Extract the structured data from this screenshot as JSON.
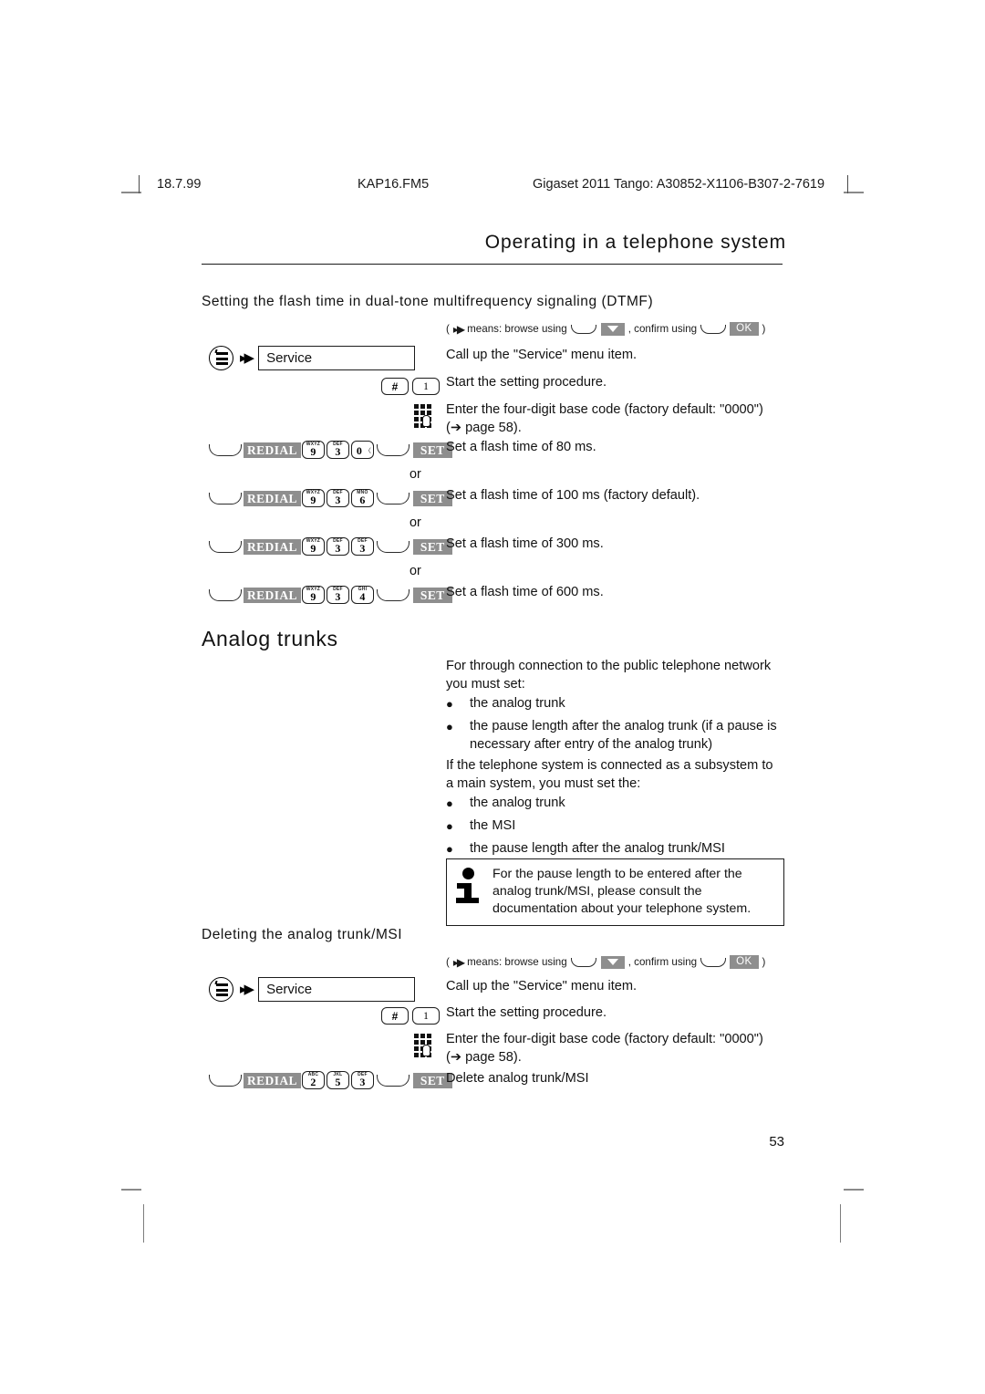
{
  "running_header": {
    "date": "18.7.99",
    "file": "KAP16.FM5",
    "doc_id": "Gigaset 2011 Tango: A30852-X1106-B307-2-7619"
  },
  "chapter_title": "Operating in a telephone system",
  "sections": {
    "dtmf": {
      "heading": "Setting the flash time in dual-tone multifrequency signaling (DTMF)",
      "legend_prefix": "(",
      "legend_means": "means: browse using",
      "legend_confirm": ", confirm using",
      "legend_suffix": ")",
      "ok_label": "OK",
      "service_value": "Service",
      "steps": {
        "call_service": "Call up the \"Service\" menu item.",
        "start_procedure": "Start the setting procedure.",
        "enter_code_line1": "Enter the four-digit base code (factory default: \"0000\")",
        "enter_code_line2": "(➔ page 58)."
      },
      "hash_key": "#",
      "one_key": "1",
      "redial_label": "REDIAL",
      "set_label": "SET",
      "or_label": "or",
      "flash_rows": [
        {
          "keys": [
            {
              "letters": "WXYZ",
              "digit": "9"
            },
            {
              "letters": "DEF",
              "digit": "3"
            },
            {
              "letters": "",
              "digit": "0"
            }
          ],
          "description": "Set a flash time of 80 ms."
        },
        {
          "keys": [
            {
              "letters": "WXYZ",
              "digit": "9"
            },
            {
              "letters": "DEF",
              "digit": "3"
            },
            {
              "letters": "MNO",
              "digit": "6"
            }
          ],
          "description": "Set a flash time of 100 ms (factory default)."
        },
        {
          "keys": [
            {
              "letters": "WXYZ",
              "digit": "9"
            },
            {
              "letters": "DEF",
              "digit": "3"
            },
            {
              "letters": "DEF",
              "digit": "3"
            }
          ],
          "description": "Set a flash time of 300 ms."
        },
        {
          "keys": [
            {
              "letters": "WXYZ",
              "digit": "9"
            },
            {
              "letters": "DEF",
              "digit": "3"
            },
            {
              "letters": "GHI",
              "digit": "4"
            }
          ],
          "description": "Set a flash time of 600 ms."
        }
      ]
    },
    "analog_trunks": {
      "heading": "Analog trunks",
      "intro_line1": "For through connection to the public telephone network",
      "intro_line2": "you must set:",
      "bullets_1": [
        "the analog trunk",
        "the pause length after the analog trunk (if a pause is necessary after entry of the analog trunk)"
      ],
      "intro2_line1": "If the telephone system is connected as a subsystem to",
      "intro2_line2": "a main system, you must set the:",
      "bullets_2": [
        "the analog trunk",
        "the MSI",
        "the pause length after the analog trunk/MSI"
      ],
      "note": "For the pause length to be entered after the analog trunk/MSI, please consult the documentation about your telephone system."
    },
    "deleting": {
      "heading": "Deleting the analog trunk/MSI",
      "legend_prefix": "(",
      "legend_means": "means: browse using",
      "legend_confirm": ", confirm using",
      "legend_suffix": ")",
      "ok_label": "OK",
      "service_value": "Service",
      "steps": {
        "call_service": "Call up the \"Service\" menu item.",
        "start_procedure": "Start the setting procedure.",
        "enter_code_line1": "Enter the four-digit base code (factory default: \"0000\")",
        "enter_code_line2": "(➔ page 58)."
      },
      "hash_key": "#",
      "one_key": "1",
      "redial_label": "REDIAL",
      "set_label": "SET",
      "delete_row": {
        "keys": [
          {
            "letters": "ABC",
            "digit": "2"
          },
          {
            "letters": "JKL",
            "digit": "5"
          },
          {
            "letters": "DEF",
            "digit": "3"
          }
        ],
        "description": "Delete analog trunk/MSI"
      }
    }
  },
  "page_number": "53",
  "colors": {
    "label_gray": "#8e8e8e",
    "text_black": "#121212",
    "rule": "#1b1b1b"
  }
}
